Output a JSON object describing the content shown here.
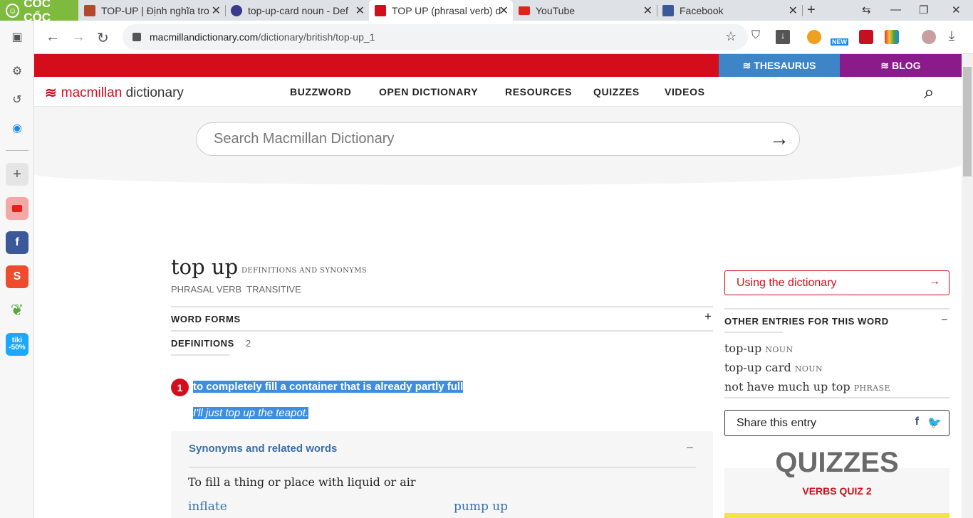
{
  "browser": {
    "brand": "CỐC CỐC",
    "tabs": [
      {
        "title": "TOP-UP | Định nghĩa tro",
        "icon": "cambridge-icon"
      },
      {
        "title": "top-up-card noun - Def",
        "icon": "oxford-icon"
      },
      {
        "title": "TOP UP (phrasal verb) d",
        "icon": "macmillan-icon",
        "active": true
      },
      {
        "title": "YouTube",
        "icon": "youtube-icon"
      },
      {
        "title": "Facebook",
        "icon": "facebook-icon"
      }
    ],
    "url_host": "macmillandictionary.com",
    "url_path": "/dictionary/british/top-up_1",
    "new_badge": "NEW"
  },
  "sidebar": {
    "tiki_label": "tiki\n-50%"
  },
  "site": {
    "thesaurus": "THESAURUS",
    "blog": "BLOG",
    "logo_mac": "macmillan",
    "logo_dict": "dictionary",
    "nav": [
      "BUZZWORD",
      "OPEN DICTIONARY",
      "RESOURCES",
      "QUIZZES",
      "VIDEOS"
    ],
    "search_placeholder": "Search Macmillan Dictionary"
  },
  "entry": {
    "headword": "top up",
    "headword_tag": "DEFINITIONS AND SYNONYMS",
    "pos": "PHRASAL VERB  TRANSITIVE",
    "word_forms": "WORD FORMS",
    "word_forms_toggle": "+",
    "definitions_label": "DEFINITIONS",
    "definitions_count": "2",
    "sense_number": "1",
    "definition": "to completely fill a container that is already partly full",
    "example": "I'll just top up the teapot.",
    "synonyms_heading": "Synonyms and related words",
    "synonyms_toggle": "–",
    "synonyms_subheading": "To fill a thing or place with liquid or air",
    "synonyms": [
      "inflate",
      "pump up"
    ]
  },
  "right": {
    "using_label": "Using the dictionary",
    "other_entries_heading": "OTHER ENTRIES FOR THIS WORD",
    "other_entries_toggle": "–",
    "other_entries": [
      {
        "word": "top-up",
        "pos": "NOUN"
      },
      {
        "word": "top-up card",
        "pos": "NOUN"
      },
      {
        "word": "not have much up top",
        "pos": "PHRASE"
      }
    ],
    "share_label": "Share this entry",
    "quiz_title": "QUIZZES",
    "quiz_sub": "VERBS QUIZ 2"
  },
  "colors": {
    "brand_red": "#d40d1c",
    "thesaurus_blue": "#3d85c6",
    "blog_purple": "#8b1a8b",
    "coccoc_green": "#7dba3d",
    "highlight": "#3d8ee0"
  }
}
